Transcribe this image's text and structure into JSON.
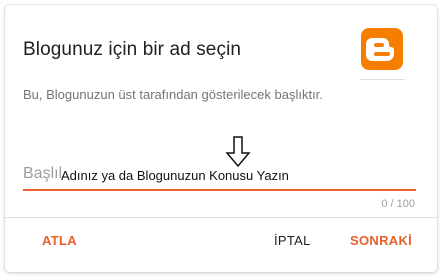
{
  "dialog": {
    "title": "Blogunuz için bir ad seçin",
    "description": "Bu, Blogunuzun üst tarafından gösterilecek başlıktır.",
    "logo_icon": "blogger-logo-icon",
    "accent_color": "#e8602c"
  },
  "title_field": {
    "label": "Başlık",
    "value": "Adınız ya da Blogunuzun Konusu Yazın",
    "counter": "0 / 100"
  },
  "annotation": {
    "icon": "down-arrow-icon"
  },
  "footer": {
    "skip_label": "ATLA",
    "cancel_label": "İPTAL",
    "next_label": "SONRAKİ"
  }
}
